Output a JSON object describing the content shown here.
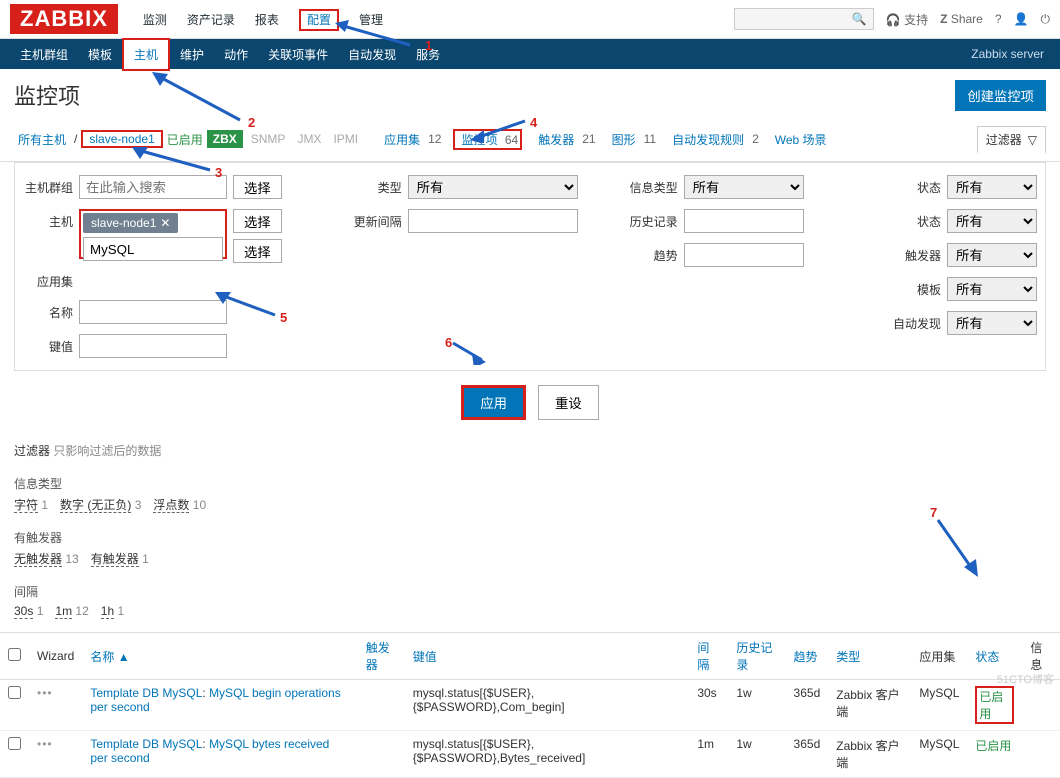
{
  "header": {
    "logo": "ZABBIX",
    "nav": [
      "监测",
      "资产记录",
      "报表",
      "配置",
      "管理"
    ],
    "support": "支持",
    "share": "Share"
  },
  "subnav": {
    "items": [
      "主机群组",
      "模板",
      "主机",
      "维护",
      "动作",
      "关联项事件",
      "自动发现",
      "服务"
    ],
    "right": "Zabbix server"
  },
  "page": {
    "title": "监控项",
    "create": "创建监控项"
  },
  "breadcrumb": {
    "all_hosts": "所有主机",
    "node": "slave-node1",
    "enabled": "已启用",
    "zbx": "ZBX",
    "snmp": "SNMP",
    "jmx": "JMX",
    "ipmi": "IPMI",
    "appset": "应用集",
    "appset_n": "12",
    "items": "监控项",
    "items_n": "64",
    "triggers": "触发器",
    "triggers_n": "21",
    "graphs": "图形",
    "graphs_n": "11",
    "discovery": "自动发现规则",
    "discovery_n": "2",
    "web": "Web 场景",
    "filter": "过滤器"
  },
  "filters": {
    "group_label": "主机群组",
    "group_ph": "在此输入搜索",
    "group_btn": "选择",
    "host_label": "主机",
    "host_tag": "slave-node1",
    "host_btn": "选择",
    "appset_label": "应用集",
    "appset_val": "MySQL",
    "appset_btn": "选择",
    "name_label": "名称",
    "key_label": "键值",
    "type_label": "类型",
    "type_val": "所有",
    "interval_label": "更新间隔",
    "info_label": "信息类型",
    "info_val": "所有",
    "history_label": "历史记录",
    "trend_label": "趋势",
    "state_label": "状态",
    "state_val": "所有",
    "status_label": "状态",
    "status_val": "所有",
    "trigger_label": "触发器",
    "trigger_val": "所有",
    "template_label": "模板",
    "template_val": "所有",
    "disc_label": "自动发现",
    "disc_val": "所有",
    "apply": "应用",
    "reset": "重设"
  },
  "meta": {
    "filter_note_label": "过滤器",
    "filter_note": "只影响过滤后的数据",
    "info_type": "信息类型",
    "char": "字符",
    "char_n": "1",
    "numu": "数字 (无正负)",
    "numu_n": "3",
    "float": "浮点数",
    "float_n": "10",
    "has_trigger": "有触发器",
    "no_trig": "无触发器",
    "no_trig_n": "13",
    "has_trig": "有触发器",
    "has_trig_n": "1",
    "interval": "间隔",
    "i30s": "30s",
    "i30s_n": "1",
    "i1m": "1m",
    "i1m_n": "12",
    "i1h": "1h",
    "i1h_n": "1"
  },
  "table": {
    "headers": {
      "wizard": "Wizard",
      "name": "名称",
      "sort": "▲",
      "triggers": "触发器",
      "key": "键值",
      "interval": "间隔",
      "history": "历史记录",
      "trend": "趋势",
      "type": "类型",
      "appset": "应用集",
      "status": "状态",
      "info": "信息"
    },
    "rows": [
      {
        "template": "Template DB MySQL",
        "name": "MySQL begin operations per second",
        "key": "mysql.status[{$USER},{$PASSWORD},Com_begin]",
        "interval": "30s",
        "history": "1w",
        "trend": "365d",
        "type": "Zabbix 客户端",
        "appset": "MySQL",
        "status": "已启用"
      },
      {
        "template": "Template DB MySQL",
        "name": "MySQL bytes received per second",
        "key": "mysql.status[{$USER},{$PASSWORD},Bytes_received]",
        "interval": "1m",
        "history": "1w",
        "trend": "365d",
        "type": "Zabbix 客户端",
        "appset": "MySQL",
        "status": "已启用"
      }
    ]
  },
  "annotations": {
    "a1": "1",
    "a2": "2",
    "a3": "3",
    "a4": "4",
    "a5": "5",
    "a6": "6",
    "a7": "7"
  },
  "watermark": "51CTO博客"
}
